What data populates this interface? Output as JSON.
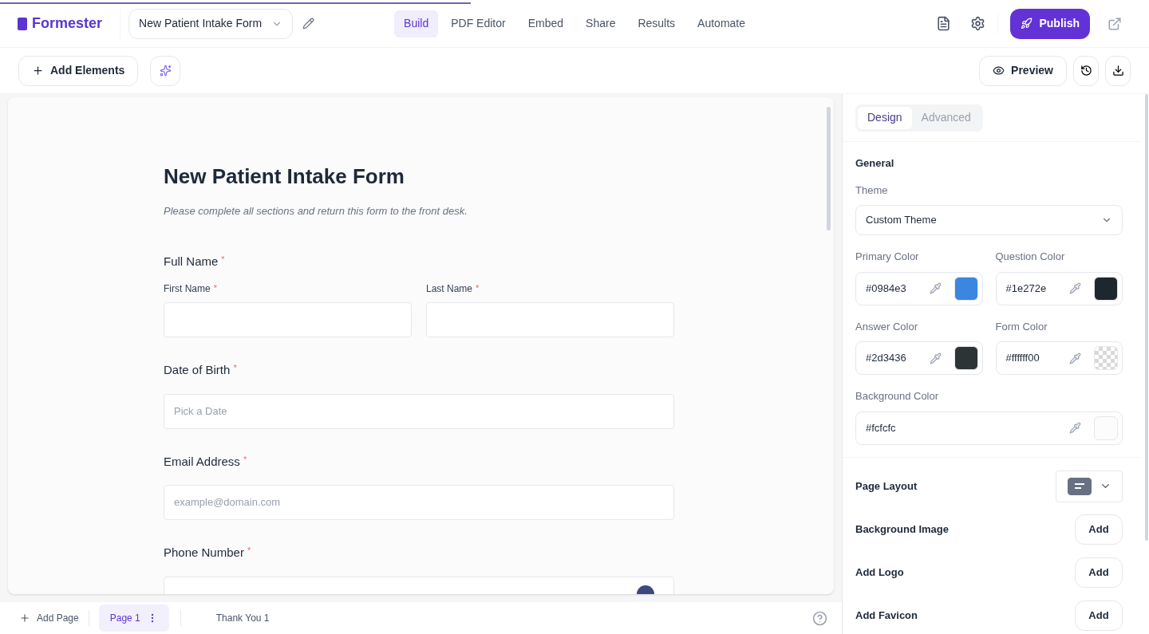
{
  "loading_bar": {
    "level": 0.41
  },
  "header": {
    "logo": "Formester",
    "form_name": "New Patient Intake Form",
    "publish": "Publish",
    "nav": [
      {
        "label": "Build",
        "selected": true
      },
      {
        "label": "PDF Editor",
        "selected": false
      },
      {
        "label": "Embed",
        "selected": false
      },
      {
        "label": "Share",
        "selected": false
      },
      {
        "label": "Results",
        "selected": false
      },
      {
        "label": "Automate",
        "selected": false
      }
    ]
  },
  "toolbar": {
    "add_elements": "Add Elements",
    "preview": "Preview"
  },
  "form": {
    "title": "New Patient Intake Form",
    "description": "Please complete all sections and return this form to the front desk.",
    "fields": [
      {
        "kind": "name",
        "label": "Full Name",
        "mark": "*",
        "parts": [
          {
            "label": "First Name",
            "mark": "*"
          },
          {
            "label": "Last Name",
            "mark": "*"
          }
        ]
      },
      {
        "kind": "text",
        "label": "Date of Birth",
        "mark": "*",
        "placeholder": "Pick a Date"
      },
      {
        "kind": "text",
        "label": "Email Address",
        "mark": "*",
        "placeholder": "example@domain.com"
      },
      {
        "kind": "phone",
        "label": "Phone Number",
        "mark": "*"
      }
    ]
  },
  "pages": {
    "add_page": "Add Page",
    "tabs": [
      {
        "label": "Page 1",
        "selected": true
      },
      {
        "label": "Thank You 1",
        "selected": false
      }
    ]
  },
  "panel": {
    "tabs": [
      {
        "label": "Design",
        "selected": true
      },
      {
        "label": "Advanced",
        "selected": false
      }
    ],
    "section": "General",
    "theme_label": "Theme",
    "theme": "Custom Theme",
    "colors": [
      {
        "label": "Primary Color",
        "value": "#0984e3",
        "kind": "solid",
        "color": "#3a86e0"
      },
      {
        "label": "Question Color",
        "value": "#1e272e",
        "kind": "solid",
        "color": "#1e272e"
      },
      {
        "label": "Answer Color",
        "value": "#2d3436",
        "kind": "solid",
        "color": "#2d3436"
      },
      {
        "label": "Form Color",
        "value": "#ffffff00",
        "kind": "checker"
      },
      {
        "label": "Background Color",
        "value": "#fcfcfc",
        "kind": "solid",
        "color": "#fcfcfc"
      }
    ],
    "page_layout": "Page Layout",
    "assets": [
      {
        "label": "Background Image",
        "button": "Add"
      },
      {
        "label": "Add Logo",
        "button": "Add"
      },
      {
        "label": "Add Favicon",
        "button": "Add"
      }
    ]
  }
}
